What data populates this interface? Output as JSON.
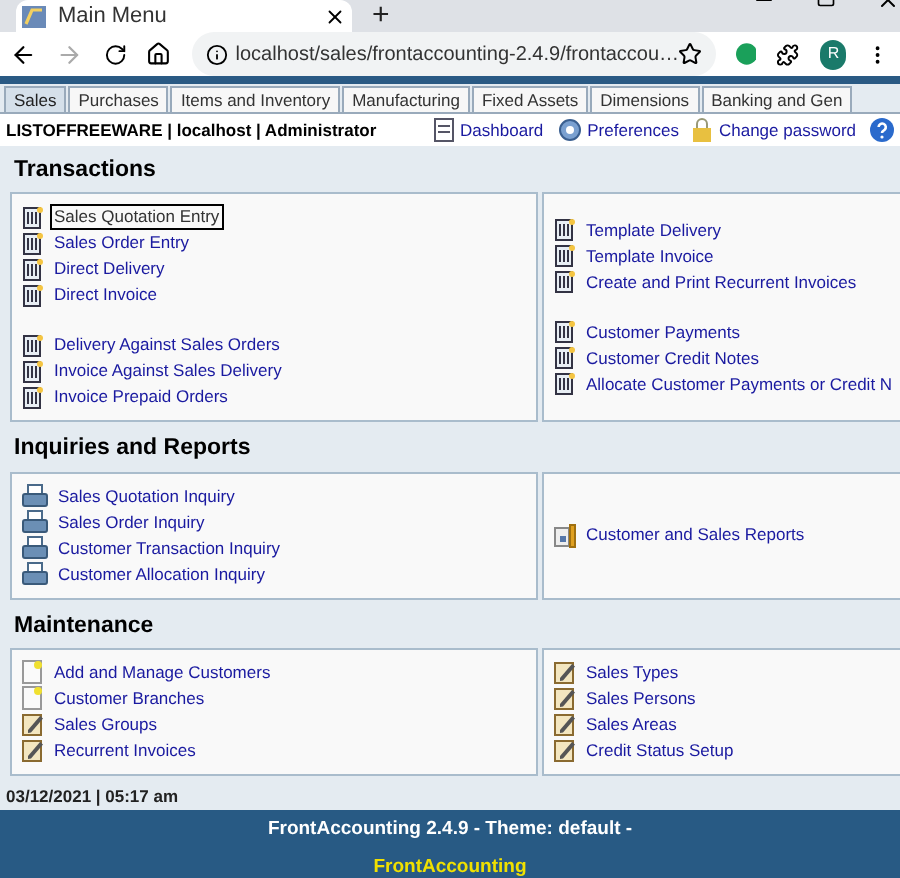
{
  "browser": {
    "tab_title": "Main Menu",
    "new_tab": "+",
    "url": "localhost/sales/frontaccounting-2.4.9/frontaccou…",
    "profile": "R"
  },
  "tabs": [
    {
      "label": "Sales",
      "selected": true
    },
    {
      "label": "Purchases",
      "selected": false
    },
    {
      "label": "Items and Inventory",
      "selected": false
    },
    {
      "label": "Manufacturing",
      "selected": false
    },
    {
      "label": "Fixed Assets",
      "selected": false
    },
    {
      "label": "Dimensions",
      "selected": false
    },
    {
      "label": "Banking and Gen",
      "selected": false
    }
  ],
  "user_bar": {
    "info": "LISTOFFREEWARE | localhost | Administrator",
    "links": [
      {
        "kind": "dashboard",
        "label": "Dashboard"
      },
      {
        "kind": "preferences",
        "label": "Preferences"
      },
      {
        "kind": "password",
        "label": "Change password"
      },
      {
        "kind": "help"
      }
    ]
  },
  "sections": [
    {
      "title": "Transactions",
      "columns": [
        {
          "groups": [
            {
              "items": [
                {
                  "kind": "transaction",
                  "label": "Sales Quotation Entry",
                  "focused": true
                },
                {
                  "kind": "transaction",
                  "label": "Sales Order Entry",
                  "focused": false
                },
                {
                  "kind": "transaction",
                  "label": "Direct Delivery",
                  "focused": false
                },
                {
                  "kind": "transaction",
                  "label": "Direct Invoice",
                  "focused": false
                }
              ]
            },
            {
              "items": [
                {
                  "kind": "transaction",
                  "label": "Delivery Against Sales Orders",
                  "focused": false
                },
                {
                  "kind": "transaction",
                  "label": "Invoice Against Sales Delivery",
                  "focused": false
                },
                {
                  "kind": "transaction",
                  "label": "Invoice Prepaid Orders",
                  "focused": false
                }
              ]
            }
          ]
        },
        {
          "groups": [
            {
              "items": [
                {
                  "kind": "transaction",
                  "label": "Template Delivery",
                  "focused": false
                },
                {
                  "kind": "transaction",
                  "label": "Template Invoice",
                  "focused": false
                },
                {
                  "kind": "transaction",
                  "label": "Create and Print Recurrent Invoices",
                  "focused": false
                }
              ]
            },
            {
              "items": [
                {
                  "kind": "transaction",
                  "label": "Customer Payments",
                  "focused": false
                },
                {
                  "kind": "transaction",
                  "label": "Customer Credit Notes",
                  "focused": false
                },
                {
                  "kind": "transaction",
                  "label": "Allocate Customer Payments or Credit N",
                  "focused": false
                }
              ]
            }
          ]
        }
      ]
    },
    {
      "title": "Inquiries and Reports",
      "columns": [
        {
          "groups": [
            {
              "items": [
                {
                  "kind": "inquiry",
                  "label": "Sales Quotation Inquiry",
                  "focused": false
                },
                {
                  "kind": "inquiry",
                  "label": "Sales Order Inquiry",
                  "focused": false
                },
                {
                  "kind": "inquiry",
                  "label": "Customer Transaction Inquiry",
                  "focused": false
                },
                {
                  "kind": "inquiry",
                  "label": "Customer Allocation Inquiry",
                  "focused": false
                }
              ]
            }
          ]
        },
        {
          "groups": [
            {
              "items": [
                {
                  "kind": "report",
                  "label": "Customer and Sales Reports",
                  "focused": false
                }
              ]
            }
          ]
        }
      ]
    },
    {
      "title": "Maintenance",
      "columns": [
        {
          "groups": [
            {
              "items": [
                {
                  "kind": "record",
                  "label": "Add and Manage Customers",
                  "focused": false
                },
                {
                  "kind": "record",
                  "label": "Customer Branches",
                  "focused": false
                },
                {
                  "kind": "setup",
                  "label": "Sales Groups",
                  "focused": false
                },
                {
                  "kind": "setup",
                  "label": "Recurrent Invoices",
                  "focused": false
                }
              ]
            }
          ]
        },
        {
          "groups": [
            {
              "items": [
                {
                  "kind": "setup",
                  "label": "Sales Types",
                  "focused": false
                },
                {
                  "kind": "setup",
                  "label": "Sales Persons",
                  "focused": false
                },
                {
                  "kind": "setup",
                  "label": "Sales Areas",
                  "focused": false
                },
                {
                  "kind": "setup",
                  "label": "Credit Status Setup",
                  "focused": false
                }
              ]
            }
          ]
        }
      ]
    }
  ],
  "date_line": "03/12/2021 | 05:17 am",
  "footer": {
    "version": "FrontAccounting 2.4.9 - Theme: default -",
    "brand": "FrontAccounting"
  }
}
